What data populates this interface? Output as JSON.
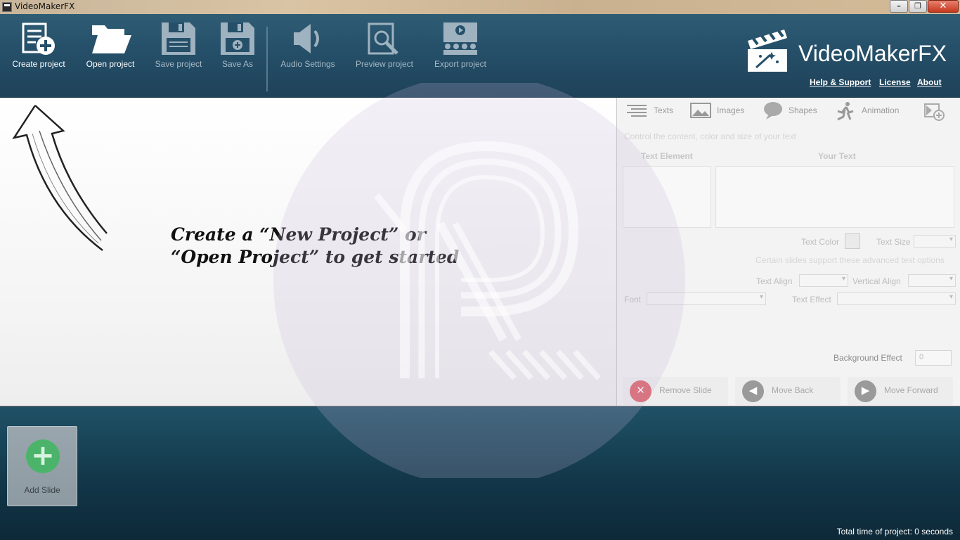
{
  "window": {
    "title": "VideoMakerFX",
    "minimize": "–",
    "maximize": "❐",
    "close": "✕"
  },
  "toolbar": {
    "create_project": "Create project",
    "open_project": "Open project",
    "save_project": "Save project",
    "save_as": "Save As",
    "audio_settings": "Audio Settings",
    "preview_project": "Preview project",
    "export_project": "Export project"
  },
  "brand": {
    "name": "VideoMakerFX",
    "help": "Help & Support",
    "license": "License",
    "about": "About"
  },
  "hint": {
    "line1": "Create a “New Project”  or",
    "line2": "“Open Project” to get started"
  },
  "panel": {
    "tabs": {
      "texts": "Texts",
      "images": "Images",
      "shapes": "Shapes",
      "animation": "Animation"
    },
    "description": "Control the content, color and size of your text",
    "text_element_header": "Text Element",
    "your_text_header": "Your Text",
    "text_color": "Text Color",
    "text_size": "Text Size",
    "advanced_note": "Certain slides support these advanced text options",
    "text_align": "Text Align",
    "vertical_align": "Vertical Align",
    "font": "Font",
    "text_effect": "Text Effect",
    "background_effect": "Background Effect",
    "background_effect_value": "0",
    "remove_slide": "Remove Slide",
    "move_back": "Move Back",
    "move_forward": "Move Forward"
  },
  "timeline": {
    "add_slide": "Add Slide",
    "total_time": "Total time of project: 0 seconds"
  },
  "colors": {
    "toolbar_bg": "#26506a",
    "add_slide_green": "#4cb46a",
    "remove_red": "#d9434a"
  }
}
